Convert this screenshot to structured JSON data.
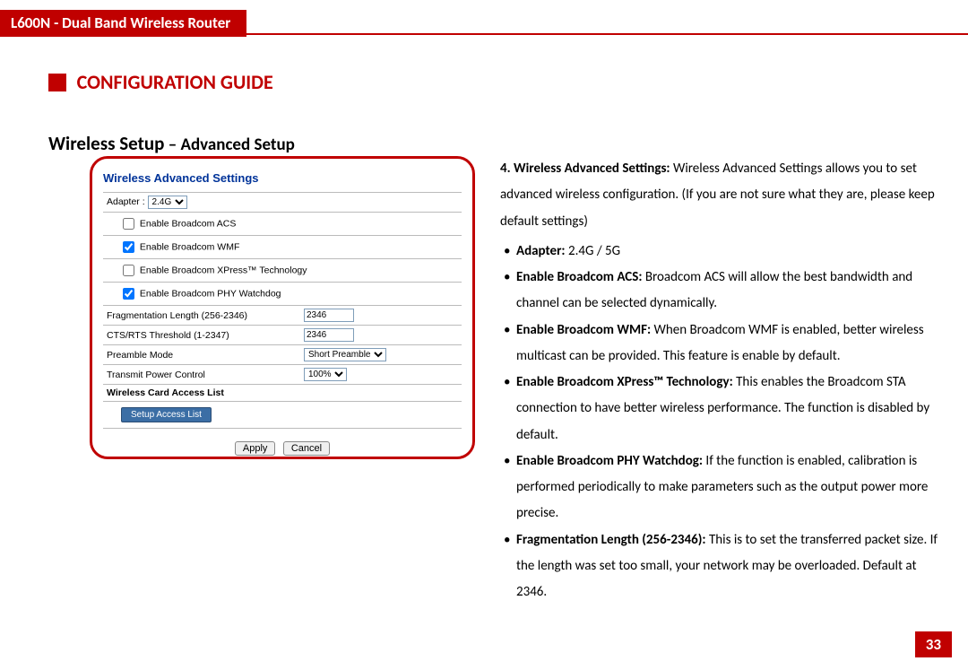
{
  "header": {
    "title": "L600N - Dual Band Wireless Router"
  },
  "guide": {
    "label": "CONFIGURATION GUIDE"
  },
  "section": {
    "main": "Wireless Setup",
    "sep": " – ",
    "sub": "Advanced Setup"
  },
  "panel": {
    "title": "Wireless Advanced Settings",
    "adapter_label": "Adapter :",
    "adapter_value": "2.4G",
    "cb_acs": "Enable Broadcom ACS",
    "cb_wmf": "Enable Broadcom WMF",
    "cb_xpress": "Enable Broadcom XPress™ Technology",
    "cb_phy": "Enable Broadcom PHY Watchdog",
    "frag_label": "Fragmentation Length (256-2346)",
    "frag_val": "2346",
    "cts_label": "CTS/RTS Threshold (1-2347)",
    "cts_val": "2346",
    "preamble_label": "Preamble Mode",
    "preamble_val": "Short Preamble",
    "tx_label": "Transmit Power Control",
    "tx_val": "100%",
    "access_label": "Wireless Card Access List",
    "access_btn": "Setup Access List",
    "apply": "Apply",
    "cancel": "Cancel"
  },
  "desc": {
    "intro_bold": "4. Wireless Advanced Settings:",
    "intro_text": " Wireless Advanced Settings allows you to set advanced wireless configuration. (If you are not sure what they are, please keep default settings)",
    "items": [
      {
        "b": "Adapter:",
        "t": " 2.4G / 5G"
      },
      {
        "b": "Enable Broadcom ACS:",
        "t": "  Broadcom ACS will allow the best bandwidth and channel can be selected dynamically."
      },
      {
        "b": "Enable Broadcom WMF:",
        "t": " When Broadcom WMF is enabled, better wireless multicast can be provided. This feature is enable by default."
      },
      {
        "b": "Enable Broadcom XPress™ Technology:",
        "t": " This enables the Broadcom STA connection to have better wireless performance. The function is disabled by default."
      },
      {
        "b": "Enable Broadcom PHY Watchdog:",
        "t": " If the function is enabled, calibration is performed periodically to make parameters such as the output power more precise."
      },
      {
        "b": "Fragmentation Length (256-2346):",
        "t": " This is to set the transferred packet size. If the length was set too small, your network may be overloaded. Default at 2346."
      }
    ]
  },
  "page": {
    "num": "33"
  }
}
